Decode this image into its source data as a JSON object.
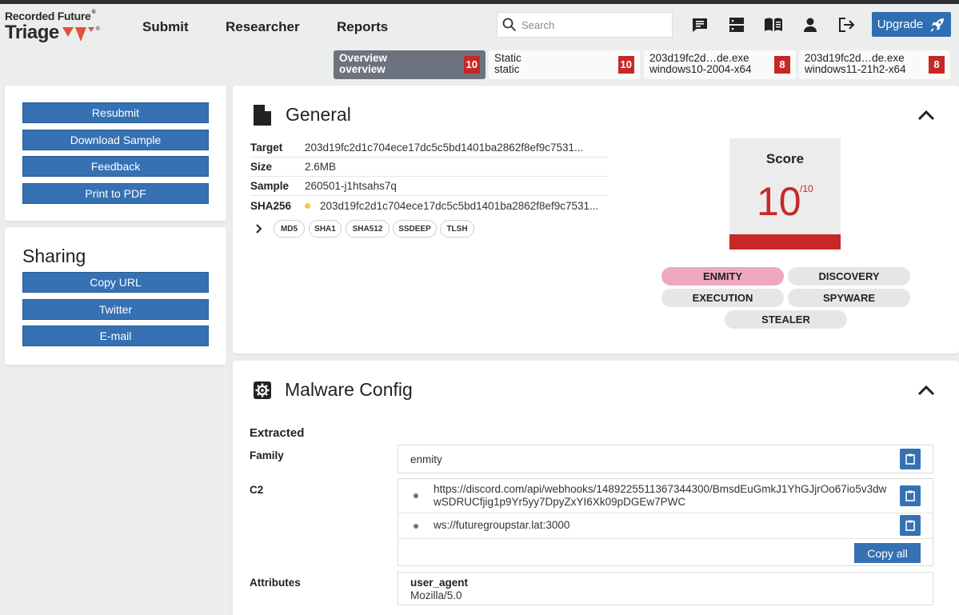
{
  "header": {
    "logo_line1": "Recorded Future",
    "logo_line2": "Triage",
    "logo_mark": "®",
    "nav": [
      "Submit",
      "Researcher",
      "Reports"
    ],
    "search_placeholder": "Search",
    "upgrade_label": "Upgrade",
    "icons": [
      "chat-icon",
      "server-icon",
      "book-icon",
      "user-icon",
      "logout-icon"
    ]
  },
  "tabs": [
    {
      "line1": "Overview",
      "line2": "overview",
      "score": "10",
      "active": true
    },
    {
      "line1": "Static",
      "line2": "static",
      "score": "10",
      "active": false
    },
    {
      "line1": "203d19fc2d…de.exe",
      "line2": "windows10-2004-x64",
      "score": "8",
      "active": false
    },
    {
      "line1": "203d19fc2d…de.exe",
      "line2": "windows11-21h2-x64",
      "score": "8",
      "active": false
    }
  ],
  "actions": [
    "Resubmit",
    "Download Sample",
    "Feedback",
    "Print to PDF"
  ],
  "sharing": {
    "title": "Sharing",
    "buttons": [
      "Copy URL",
      "Twitter",
      "E-mail"
    ]
  },
  "general": {
    "title": "General",
    "rows": [
      {
        "key": "Target",
        "value": "203d19fc2d1c704ece17dc5c5bd1401ba2862f8ef9c7531..."
      },
      {
        "key": "Size",
        "value": "2.6MB"
      },
      {
        "key": "Sample",
        "value": "260501-j1htsahs7q"
      },
      {
        "key": "SHA256",
        "value": "203d19fc2d1c704ece17dc5c5bd1401ba2862f8ef9c7531..."
      }
    ],
    "hashes": [
      "MD5",
      "SHA1",
      "SHA512",
      "SSDEEP",
      "TLSH"
    ],
    "score_label": "Score",
    "score": "10",
    "score_max": "/10",
    "score_color": "#c62828",
    "tags": [
      {
        "label": "ENMITY",
        "highlight": true
      },
      {
        "label": "DISCOVERY",
        "highlight": false
      },
      {
        "label": "EXECUTION",
        "highlight": false
      },
      {
        "label": "SPYWARE",
        "highlight": false
      },
      {
        "label": "STEALER",
        "highlight": false
      }
    ]
  },
  "malware_config": {
    "title": "Malware Config",
    "extracted_label": "Extracted",
    "family_label": "Family",
    "family": "enmity",
    "c2_label": "C2",
    "c2": [
      "https://discord.com/api/webhooks/1489225511367344300/BmsdEuGmkJ1YhGJjrOo67io5v3dwwSDRUCfjig1p9Yr5yy7DpyZxYI6Xk09pDGEw7PWC",
      "ws://futuregroupstar.lat:3000"
    ],
    "copy_all_label": "Copy all",
    "attributes_label": "Attributes",
    "attr_key": "user_agent",
    "attr_value": "Mozilla/5.0"
  },
  "colors": {
    "accent": "#3571b3",
    "danger": "#c62828",
    "tag_highlight": "#efa7c1"
  }
}
